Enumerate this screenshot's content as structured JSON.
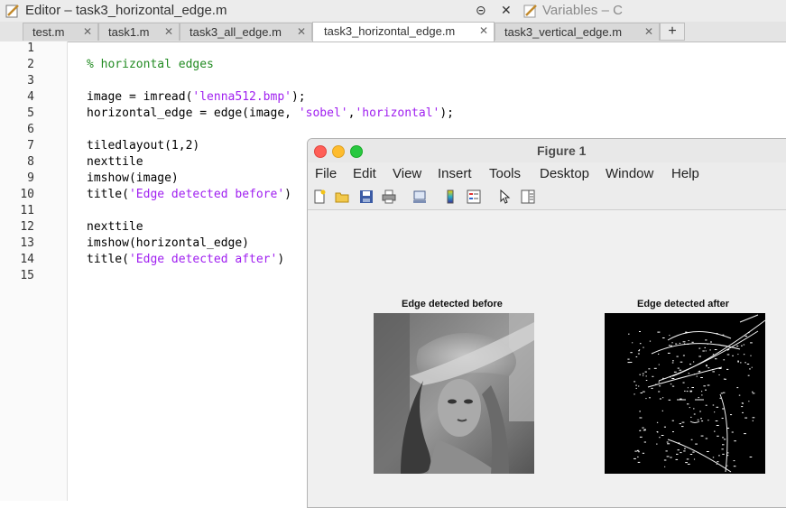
{
  "editor": {
    "title": "Editor – task3_horizontal_edge.m",
    "variables_title": "Variables – C",
    "tabs": [
      {
        "label": "test.m"
      },
      {
        "label": "task1.m"
      },
      {
        "label": "task3_all_edge.m"
      },
      {
        "label": "task3_horizontal_edge.m"
      },
      {
        "label": "task3_vertical_edge.m"
      }
    ],
    "add_tab_label": "+",
    "close_glyph": "✕",
    "line_numbers": [
      "1",
      "2",
      "3",
      "4",
      "5",
      "6",
      "7",
      "8",
      "9",
      "10",
      "11",
      "12",
      "13",
      "14",
      "15"
    ],
    "code": {
      "l2_comment": "% horizontal edges",
      "l4_a": "image = imread(",
      "l4_str": "'lenna512.bmp'",
      "l4_b": ");",
      "l5_a": "horizontal_edge = edge(image, ",
      "l5_str1": "'sobel'",
      "l5_mid": ",",
      "l5_str2": "'horizontal'",
      "l5_b": ");",
      "l7": "tiledlayout(1,2)",
      "l8": "nexttile",
      "l9": "imshow(image)",
      "l10_a": "title(",
      "l10_str": "'Edge detected before'",
      "l10_b": ")",
      "l12": "nexttile",
      "l13": "imshow(horizontal_edge)",
      "l14_a": "title(",
      "l14_str": "'Edge detected after'",
      "l14_b": ")"
    }
  },
  "figure": {
    "window_title": "Figure 1",
    "menu": [
      "File",
      "Edit",
      "View",
      "Insert",
      "Tools",
      "Desktop",
      "Window",
      "Help"
    ],
    "toolbar_icons": [
      "new-figure-icon",
      "open-file-icon",
      "save-icon",
      "print-icon",
      "link-plot-icon",
      "insert-colorbar-icon",
      "insert-legend-icon",
      "edit-plot-cursor-icon",
      "property-inspector-icon"
    ],
    "axes_left_title": "Edge detected before",
    "axes_right_title": "Edge detected after"
  },
  "colors": {
    "comment": "#228b22",
    "string": "#a020f0",
    "close_light": "#ff5f57",
    "minimize_light": "#febc2e",
    "zoom_light": "#28c840"
  }
}
